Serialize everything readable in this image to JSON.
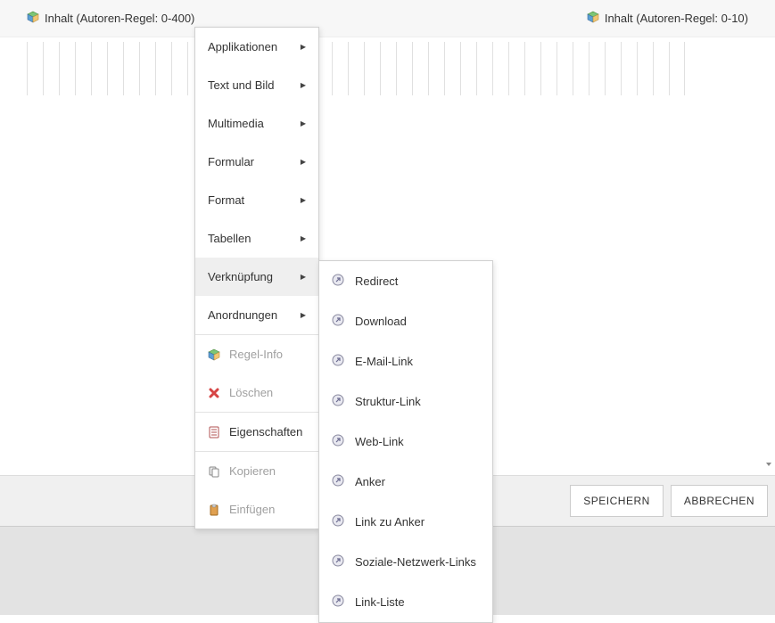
{
  "header": {
    "left_label": "Inhalt (Autoren-Regel: 0-400)",
    "right_label": "Inhalt (Autoren-Regel: 0-10)"
  },
  "contextMenu": {
    "items": [
      {
        "label": "Applikationen"
      },
      {
        "label": "Text und Bild"
      },
      {
        "label": "Multimedia"
      },
      {
        "label": "Formular"
      },
      {
        "label": "Format"
      },
      {
        "label": "Tabellen"
      },
      {
        "label": "Verknüpfung"
      },
      {
        "label": "Anordnungen"
      }
    ],
    "actions": {
      "regelInfo": "Regel-Info",
      "loeschen": "Löschen",
      "eigenschaften": "Eigenschaften",
      "kopieren": "Kopieren",
      "einfuegen": "Einfügen"
    }
  },
  "submenu": {
    "items": [
      {
        "label": "Redirect"
      },
      {
        "label": "Download"
      },
      {
        "label": "E-Mail-Link"
      },
      {
        "label": "Struktur-Link"
      },
      {
        "label": "Web-Link"
      },
      {
        "label": "Anker"
      },
      {
        "label": "Link zu Anker"
      },
      {
        "label": "Soziale-Netzwerk-Links"
      },
      {
        "label": "Link-Liste"
      }
    ]
  },
  "footer": {
    "save": "SPEICHERN",
    "cancel": "ABBRECHEN"
  }
}
